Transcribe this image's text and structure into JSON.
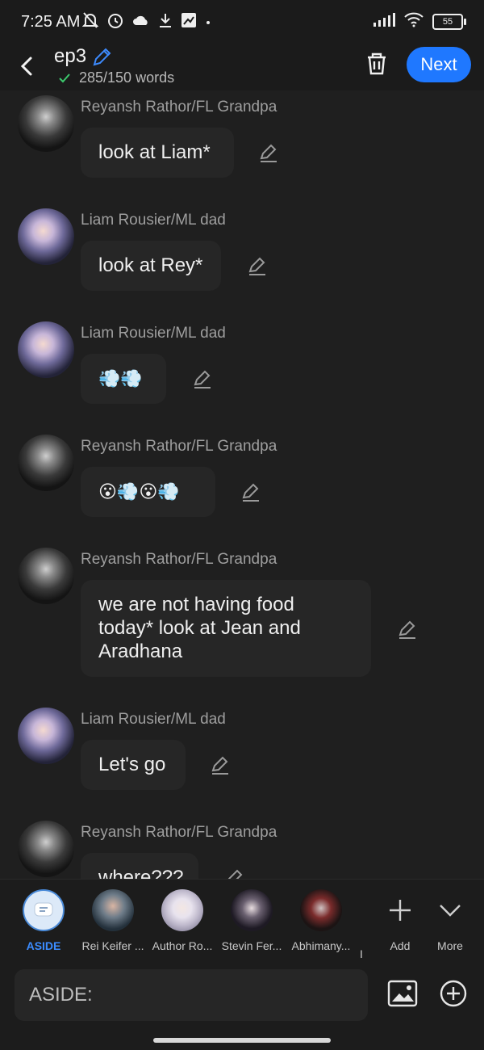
{
  "status": {
    "time": "7:25 AM",
    "battery": "55"
  },
  "header": {
    "title": "ep3",
    "word_count": "285/150 words",
    "next_label": "Next",
    "accent": "#1f78ff"
  },
  "messages": [
    {
      "name": "Reyansh Rathor/FL Grandpa",
      "text": "look at Liam*"
    },
    {
      "name": "Liam Rousier/ML dad",
      "text": "look at Rey*"
    },
    {
      "name": "Liam Rousier/ML dad",
      "text": "💨💨"
    },
    {
      "name": "Reyansh Rathor/FL Grandpa",
      "text": "😮💨😮💨"
    },
    {
      "name": "Reyansh Rathor/FL Grandpa",
      "text": "we are not having food today* look at Jean and Aradhana"
    },
    {
      "name": "Liam Rousier/ML dad",
      "text": "Let's go"
    },
    {
      "name": "Reyansh Rathor/FL Grandpa",
      "text": "where???"
    }
  ],
  "characters": [
    {
      "label": "ASIDE"
    },
    {
      "label": "Rei Keifer ..."
    },
    {
      "label": "Author Ro..."
    },
    {
      "label": "Stevin Fer..."
    },
    {
      "label": "Abhimany..."
    },
    {
      "label": "I"
    }
  ],
  "actions": {
    "add_label": "Add",
    "more_label": "More"
  },
  "input": {
    "placeholder": "ASIDE:"
  }
}
